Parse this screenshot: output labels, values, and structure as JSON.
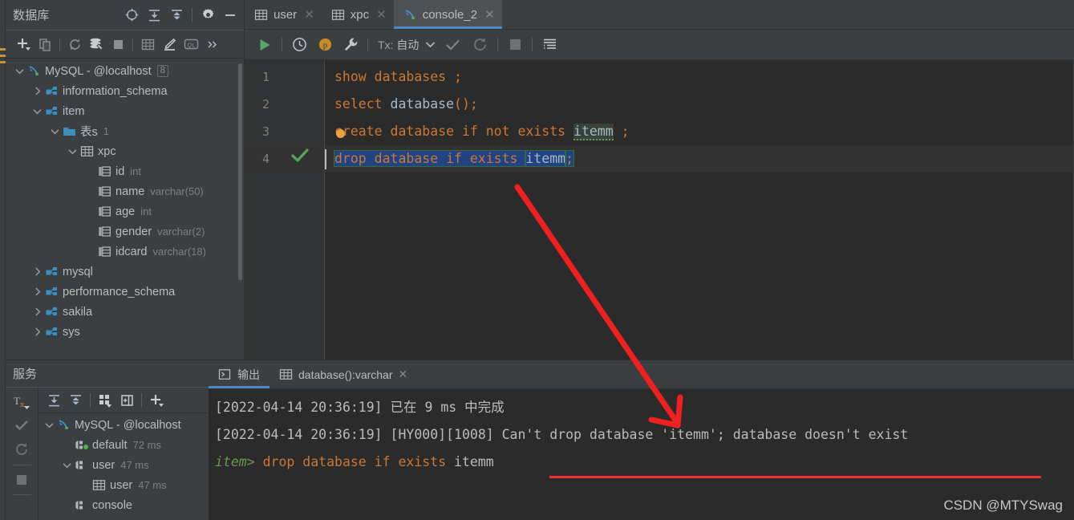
{
  "database_panel": {
    "title": "数据库",
    "header_icons": [
      "target-icon",
      "collapse-all-icon",
      "expand-all-icon",
      "settings-gear-icon",
      "minimize-icon"
    ],
    "toolbar_icons": [
      "add-icon",
      "copy-icon",
      "refresh-icon",
      "datasource-properties-icon",
      "stop-icon",
      "table-icon",
      "edit-icon",
      "query-console-icon",
      "more-icon"
    ],
    "tree": [
      {
        "label": "MySQL - @localhost",
        "badge": "8",
        "icon": "mysql-dolphin-icon",
        "arrow": "expanded",
        "indent": 0
      },
      {
        "label": "information_schema",
        "icon": "schema-icon",
        "arrow": "collapsed",
        "indent": 1
      },
      {
        "label": "item",
        "icon": "schema-icon",
        "arrow": "expanded",
        "indent": 1
      },
      {
        "label": "表s",
        "sub": "1",
        "icon": "folder-icon",
        "arrow": "expanded",
        "indent": 2
      },
      {
        "label": "xpc",
        "icon": "table-icon",
        "arrow": "expanded",
        "indent": 3
      },
      {
        "label": "id",
        "sub": "int",
        "icon": "column-icon",
        "arrow": "none",
        "indent": 4
      },
      {
        "label": "name",
        "sub": "varchar(50)",
        "icon": "column-icon",
        "arrow": "none",
        "indent": 4
      },
      {
        "label": "age",
        "sub": "int",
        "icon": "column-icon",
        "arrow": "none",
        "indent": 4
      },
      {
        "label": "gender",
        "sub": "varchar(2)",
        "icon": "column-icon",
        "arrow": "none",
        "indent": 4
      },
      {
        "label": "idcard",
        "sub": "varchar(18)",
        "icon": "column-icon",
        "arrow": "none",
        "indent": 4
      },
      {
        "label": "mysql",
        "icon": "schema-icon",
        "arrow": "collapsed",
        "indent": 1
      },
      {
        "label": "performance_schema",
        "icon": "schema-icon",
        "arrow": "collapsed",
        "indent": 1
      },
      {
        "label": "sakila",
        "icon": "schema-icon",
        "arrow": "collapsed",
        "indent": 1
      },
      {
        "label": "sys",
        "icon": "schema-icon",
        "arrow": "collapsed",
        "indent": 1
      }
    ]
  },
  "services_panel": {
    "title": "服务",
    "gutter_icons": [
      "tx-icon",
      "commit-check-icon",
      "rollback-icon",
      "stop-icon"
    ],
    "tx_label": "Tx",
    "toolbar_icons": [
      "collapse-all-icon",
      "expand-all-icon",
      "group-icon",
      "new-window-icon",
      "add-icon"
    ],
    "tree": [
      {
        "label": "MySQL - @localhost",
        "sub": "",
        "icon": "mysql-dolphin-icon",
        "arrow": "expanded",
        "indent": 0
      },
      {
        "label": "default",
        "sub": "72 ms",
        "icon": "connection-icon",
        "arrow": "none",
        "indent": 1,
        "running": true
      },
      {
        "label": "user",
        "sub": "47 ms",
        "icon": "connection-icon",
        "arrow": "expanded",
        "indent": 1
      },
      {
        "label": "user",
        "sub": "47 ms",
        "icon": "table-icon",
        "arrow": "none",
        "indent": 2
      },
      {
        "label": "console",
        "sub": "",
        "icon": "connection-icon",
        "arrow": "none",
        "indent": 1
      }
    ]
  },
  "editor": {
    "tabs": [
      {
        "label": "user",
        "icon": "table-icon",
        "active": false,
        "closable": true
      },
      {
        "label": "xpc",
        "icon": "table-icon",
        "active": false,
        "closable": true
      },
      {
        "label": "console_2",
        "icon": "mysql-dolphin-icon",
        "active": true,
        "closable": true
      }
    ],
    "toolbar": {
      "run_icon": "run-play-icon",
      "history_icon": "history-clock-icon",
      "profile_icon": "p-badge-icon",
      "wrench_icon": "wrench-icon",
      "tx_prefix": "Tx:",
      "tx_value": "自动",
      "tx_chevron": "chevron-down-icon",
      "commit_icon": "commit-check-icon",
      "rollback_icon": "rollback-icon",
      "stop_icon": "stop-icon",
      "format_icon": "layout-icon"
    },
    "lines": [
      {
        "number": "1",
        "has_check": false,
        "segments": [
          {
            "text": "show databases ;",
            "cls": "kw"
          }
        ]
      },
      {
        "number": "2",
        "has_check": false,
        "segments": [
          {
            "text": "select ",
            "cls": "kw"
          },
          {
            "text": "database",
            "cls": "idn"
          },
          {
            "text": "();",
            "cls": "kw"
          }
        ]
      },
      {
        "number": "3",
        "has_check": false,
        "segments": [
          {
            "text": "create database if not exists ",
            "cls": "kw"
          },
          {
            "text": "itemm",
            "cls": "warn"
          },
          {
            "text": " ;",
            "cls": "kw"
          }
        ]
      },
      {
        "number": "4",
        "has_check": true,
        "selected": true,
        "segments": [
          {
            "text": "drop database if exists ",
            "cls": "kw"
          },
          {
            "text": "itemm",
            "cls": "idn"
          },
          {
            "text": ";",
            "cls": "kw"
          }
        ]
      }
    ]
  },
  "output": {
    "tabs": [
      {
        "label": "输出",
        "icon": "output-console-icon",
        "active": true,
        "closable": false
      },
      {
        "label": "database():varchar",
        "icon": "table-icon",
        "active": false,
        "closable": true
      }
    ],
    "lines": [
      {
        "segments": [
          {
            "text": "item>",
            "cls": "ctx"
          },
          {
            "text": " drop database if exists ",
            "cls": "kw"
          },
          {
            "text": "itemm",
            "cls": "plain"
          }
        ]
      },
      {
        "segments": [
          {
            "text": "[2022-04-14 20:36:19] [HY000][1008] Can't drop database 'itemm'; database doesn't exist",
            "cls": "plain"
          }
        ]
      },
      {
        "segments": [
          {
            "text": "[2022-04-14 20:36:19] 已在 9 ms 中完成",
            "cls": "plain"
          }
        ]
      }
    ]
  },
  "annotation": {
    "arrow_color": "#f02020",
    "underline_color": "#f03030"
  },
  "watermark": "CSDN @MTYSwag"
}
